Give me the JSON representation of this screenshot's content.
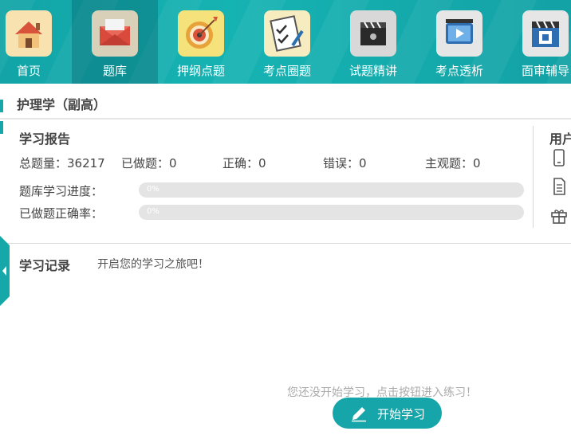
{
  "nav": {
    "items": [
      {
        "label": "首页",
        "icon": "home-icon"
      },
      {
        "label": "题库",
        "icon": "envelope-icon"
      },
      {
        "label": "押纲点题",
        "icon": "target-icon"
      },
      {
        "label": "考点圈题",
        "icon": "checklist-icon"
      },
      {
        "label": "试题精讲",
        "icon": "clapperboard-icon"
      },
      {
        "label": "考点透析",
        "icon": "video-play-icon"
      },
      {
        "label": "面审辅导",
        "icon": "clapperboard-review-icon"
      }
    ],
    "active_index": 1
  },
  "section_title": "护理学（副高）",
  "report": {
    "title": "学习报告",
    "total_label": "总题量：36217",
    "done_label": "已做题：0",
    "correct_label": "正确：0",
    "wrong_label": "错误：0",
    "subjective_label": "主观题：0",
    "progress_label": "题库学习进度：",
    "progress_value_text": "0%",
    "progress_value": 0,
    "accuracy_label": "已做题正确率：",
    "accuracy_value_text": "0%",
    "accuracy_value": 0
  },
  "user_panel": {
    "title": "用户",
    "icons": [
      "phone-icon",
      "document-icon",
      "gift-icon"
    ]
  },
  "record": {
    "title": "学习记录",
    "hint": "开启您的学习之旅吧！",
    "empty_text": "您还没开始学习，点击按钮进入练习！",
    "start_button": "开始学习"
  },
  "colors": {
    "accent": "#16a7a9",
    "text": "#444444"
  }
}
